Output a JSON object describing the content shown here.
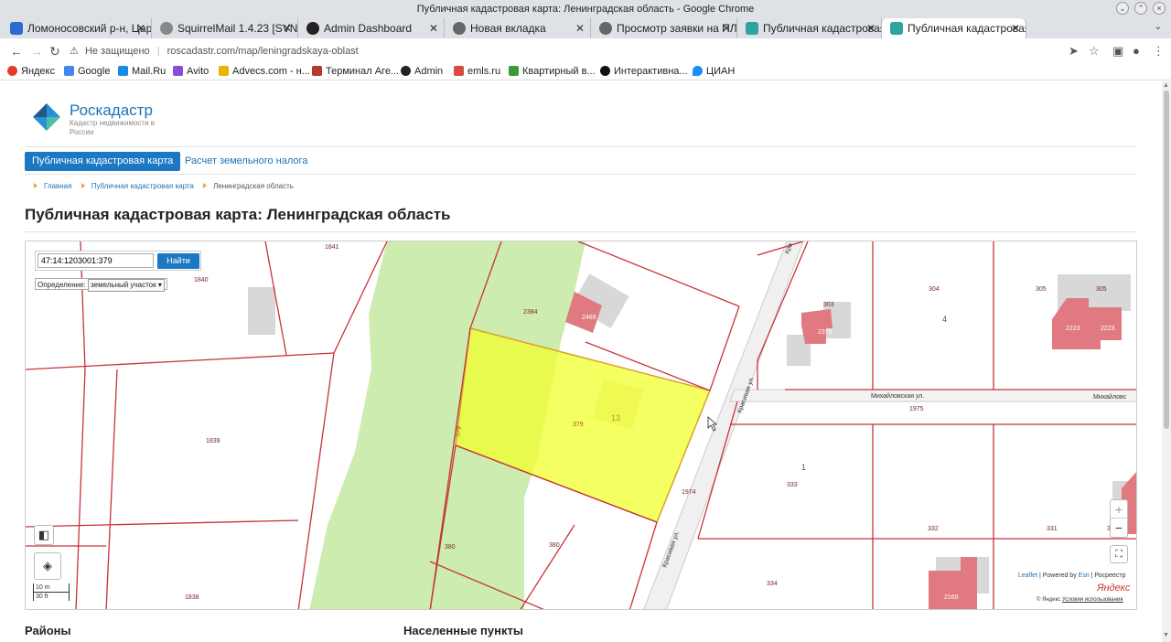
{
  "window": {
    "title": "Публичная кадастровая карта: Ленинградская область - Google Chrome"
  },
  "tabs": [
    {
      "label": "Ломоносовский р-н, Цар",
      "icon": "blue-a-icon",
      "color": "#2a6bd1"
    },
    {
      "label": "SquirrelMail 1.4.23 [SVN]",
      "icon": "squirrel-icon",
      "color": "#777777"
    },
    {
      "label": "Admin Dashboard",
      "icon": "github-icon",
      "color": "#222222"
    },
    {
      "label": "Новая вкладка",
      "icon": "globe-icon",
      "color": "#555555"
    },
    {
      "label": "Просмотр заявки на ПЛА",
      "icon": "globe-icon",
      "color": "#555555"
    },
    {
      "label": "Публичная кадастровая к",
      "icon": "rosreestr-icon",
      "color": "#2fa3a0"
    },
    {
      "label": "Публичная кадастровая к",
      "icon": "rosreestr-icon",
      "color": "#2fa3a0"
    }
  ],
  "toolbar": {
    "insecure_label": "Не защищено",
    "url": "roscadastr.com/map/leningradskaya-oblast"
  },
  "bookmarks": [
    {
      "label": "Яндекс",
      "color": "#e53b2c"
    },
    {
      "label": "Google",
      "color": "#4285f4"
    },
    {
      "label": "Mail.Ru",
      "color": "#168de2"
    },
    {
      "label": "Avito",
      "color": "#8c4dd6"
    },
    {
      "label": "Advecs.com - н...",
      "color": "#e8b400"
    },
    {
      "label": "Терминал Аге...",
      "color": "#b33a2a"
    },
    {
      "label": "Admin",
      "color": "#222222"
    },
    {
      "label": "emls.ru",
      "color": "#d94c3d"
    },
    {
      "label": "Квартирный в...",
      "color": "#3c9a3c"
    },
    {
      "label": "Интерактивна...",
      "color": "#111111"
    },
    {
      "label": "ЦИАН",
      "color": "#1a8cff"
    }
  ],
  "site": {
    "brand": "Роскадастр",
    "brand_sub": "Кадастр недвижимости в России",
    "nav": {
      "active": "Публичная кадастровая карта",
      "link": "Расчет земельного налога"
    },
    "breadcrumb": [
      "Главная",
      "Публичная кадастровая карта",
      "Ленинградская область"
    ],
    "page_title": "Публичная кадастровая карта: Ленинградская область"
  },
  "map": {
    "search_value": "47:14:1203001:379",
    "search_button": "Найти",
    "define_label": "Определение:",
    "define_value": "земельный участок",
    "zoom_in": "+",
    "zoom_out": "−",
    "scale_m": "10 m",
    "scale_ft": "30 ft",
    "attribution_leaflet": "Leaflet",
    "attribution_rest": " | Powered by ",
    "attribution_esri": "Esri",
    "attribution_end": " | Росреестр",
    "yandex_logo": "Яндекс",
    "copyright": "© Яндекс",
    "terms": "Условия использования",
    "colors": {
      "highlight": "#f0ff2e",
      "parcel_line": "#c8323c",
      "building": "#e07a80",
      "green": "#cdecb0"
    },
    "labels": {
      "p1841": "1841",
      "p1840": "1840",
      "p2384": "2384",
      "p2469": "2469",
      "p303": "303",
      "p2375": "2375",
      "p304": "304",
      "p4": "4",
      "p305a": "305",
      "p305b": "305",
      "p2223a": "2223",
      "p2223b": "2223",
      "p1839": "1839",
      "p379": "379",
      "p379b": "379",
      "p13": "13",
      "p1975": "1975",
      "p1974": "1974",
      "p1": "1",
      "p333": "333",
      "p380a": "380",
      "p380b": "380",
      "p332": "332",
      "p331": "331",
      "p331b": "331",
      "p334": "334",
      "p1838": "1838",
      "p2160": "2160",
      "kras1": "Кра",
      "street_krasivaya_a": "Красивая ул.",
      "street_krasivaya_b": "Красивая ул.",
      "street_mikh_a": "Михайловская ул.",
      "street_mikh_b": "Михайловс"
    }
  },
  "sections": {
    "left": "Районы",
    "right": "Населенные пункты"
  }
}
